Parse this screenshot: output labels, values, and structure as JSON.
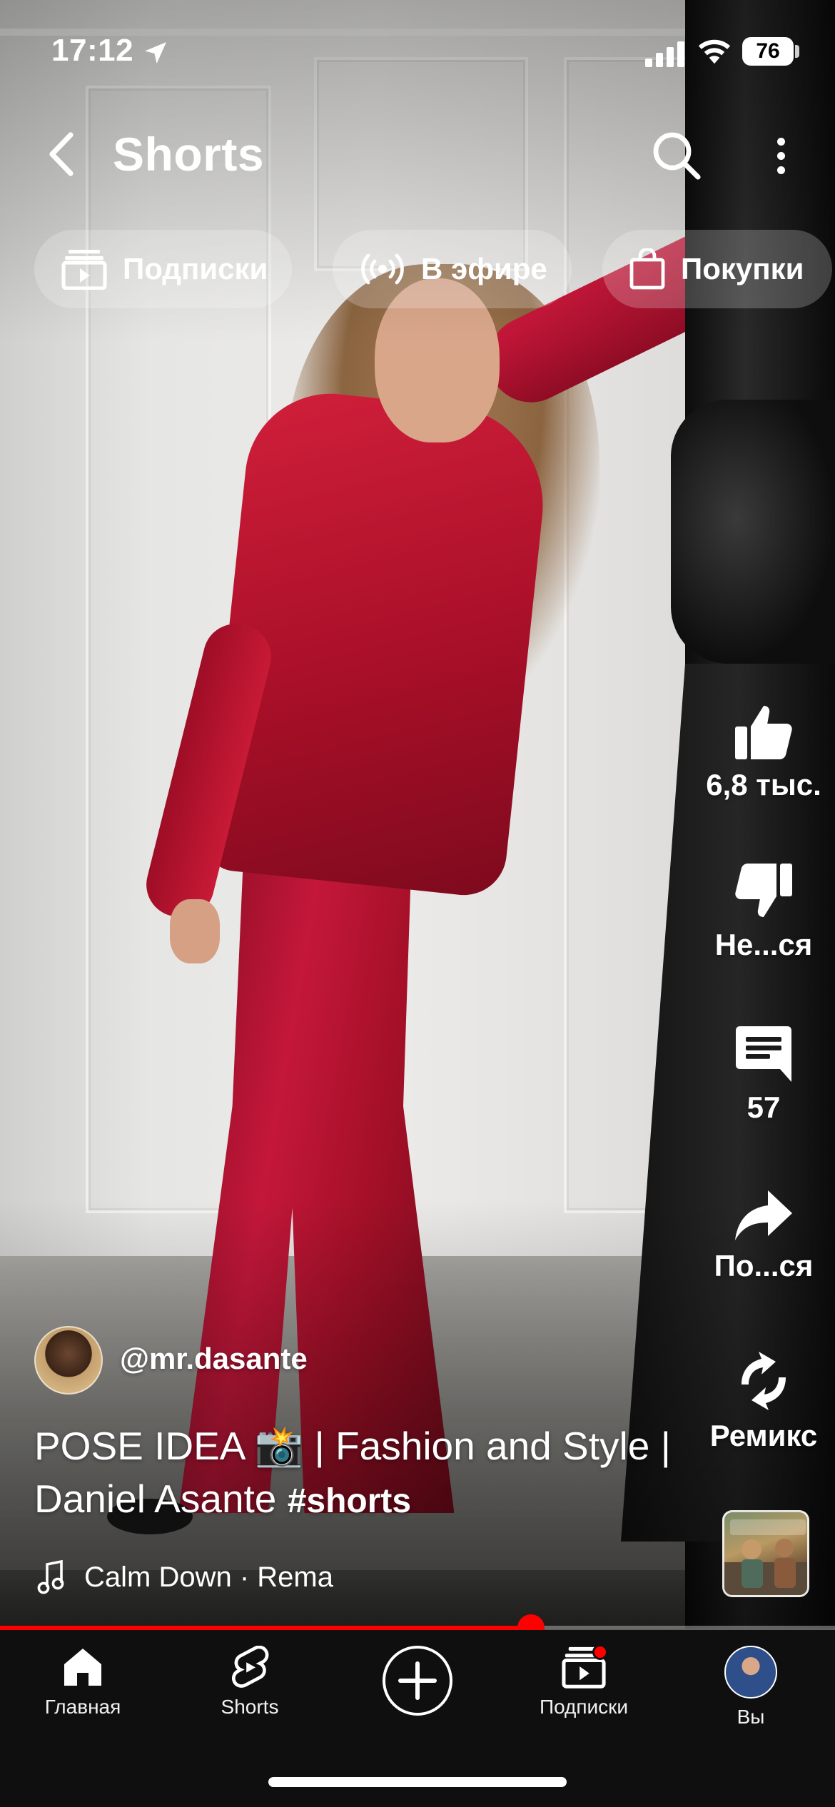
{
  "status_bar": {
    "time": "17:12",
    "battery": "76"
  },
  "header": {
    "title": "Shorts"
  },
  "chips": [
    {
      "label": "Подписки",
      "icon": "subscriptions-icon"
    },
    {
      "label": "В эфире",
      "icon": "live-broadcast-icon"
    },
    {
      "label": "Покупки",
      "icon": "shopping-bag-icon"
    }
  ],
  "actions": {
    "like": "6,8 тыс.",
    "dislike": "Не...ся",
    "comments": "57",
    "share": "По...ся",
    "remix": "Ремикс"
  },
  "video": {
    "channel": "@mr.dasante",
    "title_line1": "POSE IDEA 📸 | Fashion and Style |",
    "title_line2": "Daniel Asante",
    "hashtag": "#shorts",
    "music": "Calm Down · Rema",
    "progress": 0.636
  },
  "tab_bar": [
    {
      "label": "Главная",
      "icon": "home-icon"
    },
    {
      "label": "Shorts",
      "icon": "shorts-icon"
    },
    {
      "label": "",
      "icon": "create-plus-icon"
    },
    {
      "label": "Подписки",
      "icon": "subscriptions-icon"
    },
    {
      "label": "Вы",
      "icon": "avatar"
    }
  ],
  "colors": {
    "accent": "#ff0000",
    "bar_bg": "#0f0f0f",
    "text": "#ffffff"
  }
}
